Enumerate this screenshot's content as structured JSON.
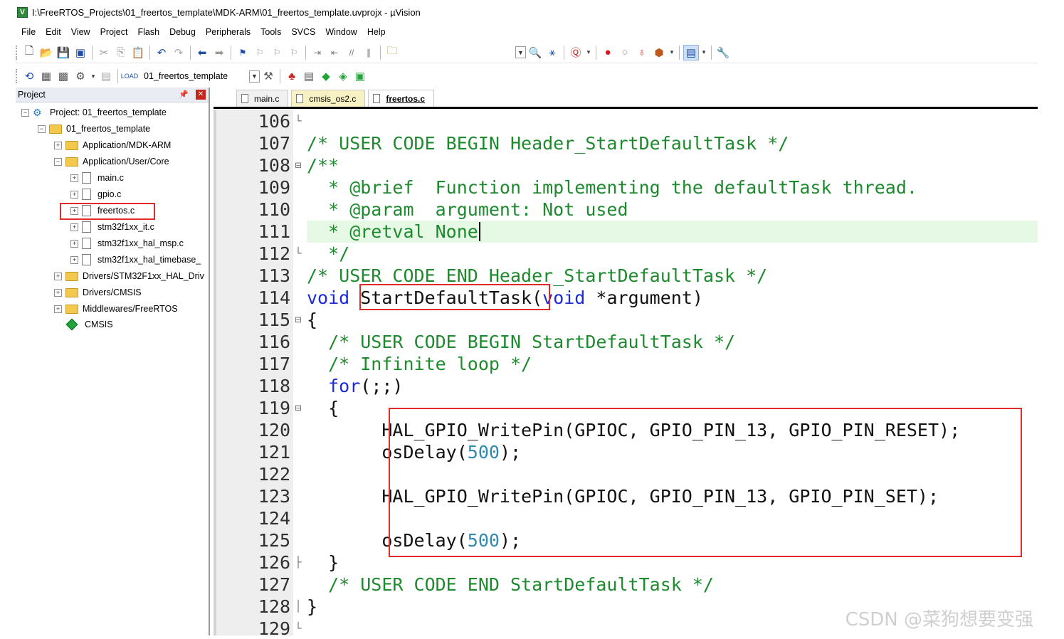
{
  "window": {
    "title": "I:\\FreeRTOS_Projects\\01_freertos_template\\MDK-ARM\\01_freertos_template.uvprojx - µVision"
  },
  "menu": [
    "File",
    "Edit",
    "View",
    "Project",
    "Flash",
    "Debug",
    "Peripherals",
    "Tools",
    "SVCS",
    "Window",
    "Help"
  ],
  "toolbar2": {
    "target": "01_freertos_template"
  },
  "project": {
    "header": "Project",
    "tree": [
      "Project: 01_freertos_template",
      "01_freertos_template",
      "Application/MDK-ARM",
      "Application/User/Core",
      "main.c",
      "gpio.c",
      "freertos.c",
      "stm32f1xx_it.c",
      "stm32f1xx_hal_msp.c",
      "stm32f1xx_hal_timebase_",
      "Drivers/STM32F1xx_HAL_Driv",
      "Drivers/CMSIS",
      "Middlewares/FreeRTOS",
      "CMSIS"
    ]
  },
  "editor": {
    "tabs": [
      "main.c",
      "cmsis_os2.c",
      "freertos.c"
    ],
    "active_tab": "freertos.c",
    "lines": [
      {
        "n": "106",
        "segs": []
      },
      {
        "n": "107",
        "segs": [
          {
            "t": "/* USER CODE BEGIN Header_StartDefaultTask */",
            "c": "comment"
          }
        ]
      },
      {
        "n": "108",
        "segs": [
          {
            "t": "/**",
            "c": "comment"
          }
        ]
      },
      {
        "n": "109",
        "segs": [
          {
            "t": "  * @brief  Function implementing the defaultTask thread.",
            "c": "comment"
          }
        ]
      },
      {
        "n": "110",
        "segs": [
          {
            "t": "  * @param  argument: Not used",
            "c": "comment"
          }
        ]
      },
      {
        "n": "111",
        "segs": [
          {
            "t": "  * @retval None",
            "c": "comment"
          }
        ]
      },
      {
        "n": "112",
        "segs": [
          {
            "t": "  */",
            "c": "comment"
          }
        ]
      },
      {
        "n": "113",
        "segs": [
          {
            "t": "/* USER CODE END Header_StartDefaultTask */",
            "c": "comment"
          }
        ]
      },
      {
        "n": "114",
        "segs": [
          {
            "t": "void",
            "c": "kw"
          },
          {
            "t": " StartDefaultTask(",
            "c": "text"
          },
          {
            "t": "void",
            "c": "kw"
          },
          {
            "t": " *argument)",
            "c": "text"
          }
        ]
      },
      {
        "n": "115",
        "segs": [
          {
            "t": "{",
            "c": "text"
          }
        ]
      },
      {
        "n": "116",
        "segs": [
          {
            "t": "  /* USER CODE BEGIN StartDefaultTask */",
            "c": "comment"
          }
        ]
      },
      {
        "n": "117",
        "segs": [
          {
            "t": "  /* Infinite loop */",
            "c": "comment"
          }
        ]
      },
      {
        "n": "118",
        "segs": [
          {
            "t": "  ",
            "c": "text"
          },
          {
            "t": "for",
            "c": "kw"
          },
          {
            "t": "(;;)",
            "c": "text"
          }
        ]
      },
      {
        "n": "119",
        "segs": [
          {
            "t": "  {",
            "c": "text"
          }
        ]
      },
      {
        "n": "120",
        "segs": [
          {
            "t": "       HAL_GPIO_WritePin(GPIOC, GPIO_PIN_13, GPIO_PIN_RESET);",
            "c": "text"
          }
        ]
      },
      {
        "n": "121",
        "segs": [
          {
            "t": "       osDelay(",
            "c": "text"
          },
          {
            "t": "500",
            "c": "num"
          },
          {
            "t": ");",
            "c": "text"
          }
        ]
      },
      {
        "n": "122",
        "segs": []
      },
      {
        "n": "123",
        "segs": [
          {
            "t": "       HAL_GPIO_WritePin(GPIOC, GPIO_PIN_13, GPIO_PIN_SET);",
            "c": "text"
          }
        ]
      },
      {
        "n": "124",
        "segs": []
      },
      {
        "n": "125",
        "segs": [
          {
            "t": "       osDelay(",
            "c": "text"
          },
          {
            "t": "500",
            "c": "num"
          },
          {
            "t": ");",
            "c": "text"
          }
        ]
      },
      {
        "n": "126",
        "segs": [
          {
            "t": "  }",
            "c": "text"
          }
        ]
      },
      {
        "n": "127",
        "segs": [
          {
            "t": "  /* USER CODE END StartDefaultTask */",
            "c": "comment"
          }
        ]
      },
      {
        "n": "128",
        "segs": [
          {
            "t": "}",
            "c": "text"
          }
        ]
      },
      {
        "n": "129",
        "segs": []
      }
    ],
    "current_line": "111"
  },
  "watermark": "CSDN @菜狗想要变强",
  "colors": {
    "comment": "#1e8a2e",
    "keyword": "#1c2bd6",
    "number": "#2e8ab0",
    "highlight_box": "#e02b2b",
    "current_line": "#e5f9e5"
  }
}
